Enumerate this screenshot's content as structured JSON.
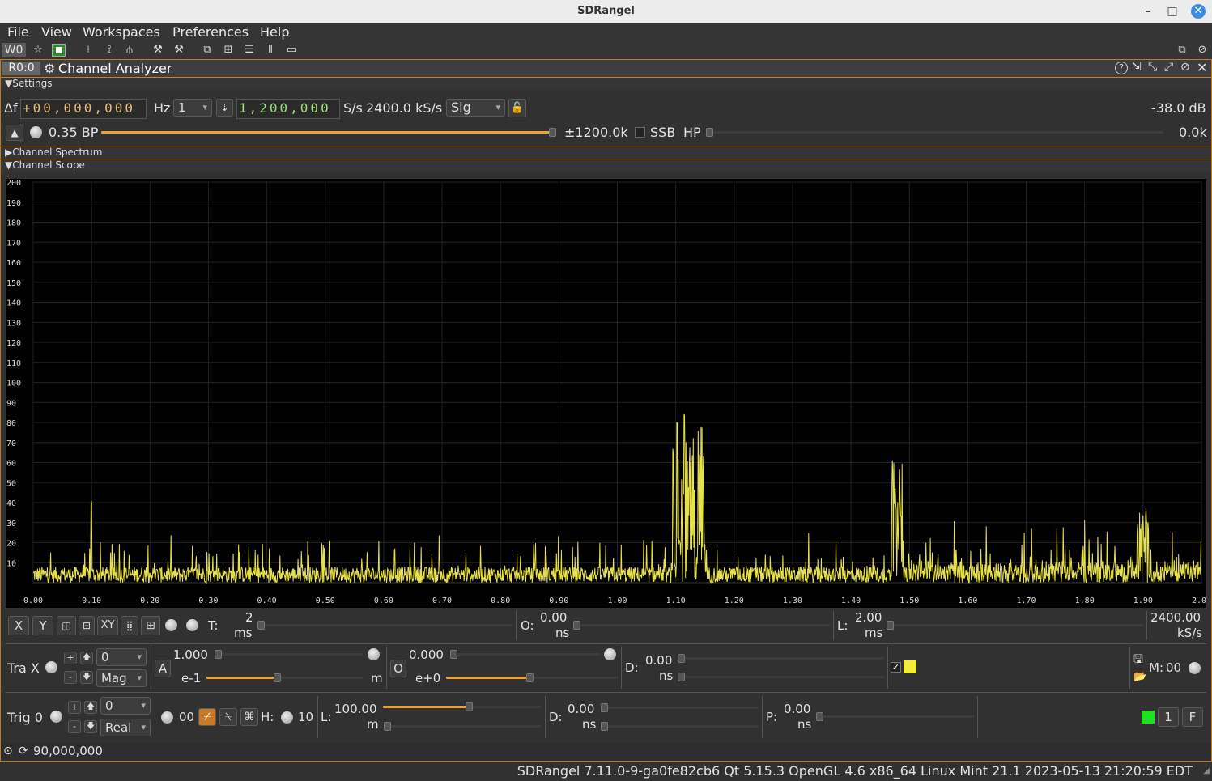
{
  "window": {
    "title": "SDRangel"
  },
  "menu": [
    "File",
    "View",
    "Workspaces",
    "Preferences",
    "Help"
  ],
  "toolbar": {
    "workspace": "W0"
  },
  "channel": {
    "id": "R0:0",
    "title": "Channel Analyzer",
    "sections": {
      "settings": "Settings",
      "spectrum": "Channel Spectrum",
      "scope": "Channel Scope"
    },
    "delta_f_label": "Δf",
    "delta_f_value": "+00,000,000",
    "hz_unit": "Hz",
    "decim": "1",
    "sample_rate_value": "1,200,000",
    "sr_unit": "S/s",
    "sr_readout": "2400.0 kS/s",
    "source": "Sig",
    "power": "-38.0 dB",
    "bp_label": "0.35 BP",
    "bw": "±1200.0k",
    "ssb_label": "SSB",
    "hp_label": "HP",
    "lowcut": "0.0k"
  },
  "scope": {
    "chart_data": {
      "type": "line",
      "xlabel": "",
      "ylabel": "",
      "xlim": [
        0.0,
        2.0
      ],
      "ylim": [
        0,
        200
      ],
      "y_ticks": [
        "200",
        "190",
        "180",
        "170",
        "160",
        "150",
        "140",
        "130",
        "120",
        "110",
        "100",
        "90",
        "80",
        "70",
        "60",
        "50",
        "40",
        "30",
        "20",
        "10"
      ],
      "x_ticks": [
        "0.00",
        "0.10",
        "0.20",
        "0.30",
        "0.40",
        "0.50",
        "0.60",
        "0.70",
        "0.80",
        "0.90",
        "1.00",
        "1.10",
        "1.20",
        "1.30",
        "1.40",
        "1.50",
        "1.60",
        "1.70",
        "1.80",
        "1.90",
        "2.00"
      ],
      "series": [
        {
          "color": "#e6e04a",
          "noise_floor": 8,
          "noise_peak": 25,
          "bursts": [
            {
              "x0": 1.095,
              "x1": 1.15,
              "peak": 86
            },
            {
              "x0": 1.47,
              "x1": 1.49,
              "peak": 66
            },
            {
              "x0": 0.098,
              "x1": 0.1,
              "peak": 43
            },
            {
              "x0": 1.89,
              "x1": 1.91,
              "peak": 40
            }
          ]
        }
      ],
      "grid": true
    }
  },
  "controls": {
    "time_label": "T:",
    "time_value": "2",
    "time_unit": "ms",
    "offset_label": "O:",
    "offset_value": "0.00",
    "offset_unit": "ns",
    "length_label": "L:",
    "length_value": "2.00",
    "length_unit": "ms",
    "rate_value": "2400.00",
    "rate_unit": "kS/s",
    "x_btn": "X",
    "y_btn": "Y",
    "xy_btn": "XY",
    "trace_label": "Tra X",
    "trace_index": "0",
    "trace_proj": "Mag",
    "amp_value": "1.000",
    "amp_exp": "e-1",
    "amp_unit": "m",
    "a_btn": "A",
    "ofs_value": "0.000",
    "ofs_exp": "e+0",
    "o_btn": "O",
    "delay_label": "D:",
    "delay_value": "0.00",
    "delay_unit": "ns",
    "mem_label": "M:",
    "mem_value": "00",
    "trig_label": "Trig 0",
    "trig_index": "0",
    "trig_proj": "Real",
    "trig_count": "00",
    "h_label": "H:",
    "h_value": "10",
    "level_label": "L:",
    "level_value": "100.00",
    "level_unit": "m",
    "tdelay_label": "D:",
    "tdelay_value": "0.00",
    "tdelay_unit": "ns",
    "pre_label": "P:",
    "pre_value": "0.00",
    "pre_unit": "ns",
    "trig_num": "1",
    "f_btn": "F"
  },
  "device_freq": "90,000,000",
  "status": "SDRangel 7.11.0-9-ga0fe82cb6 Qt 5.15.3 OpenGL 4.6 x86_64 Linux Mint 21.1 2023-05-13 21:20:59 EDT"
}
